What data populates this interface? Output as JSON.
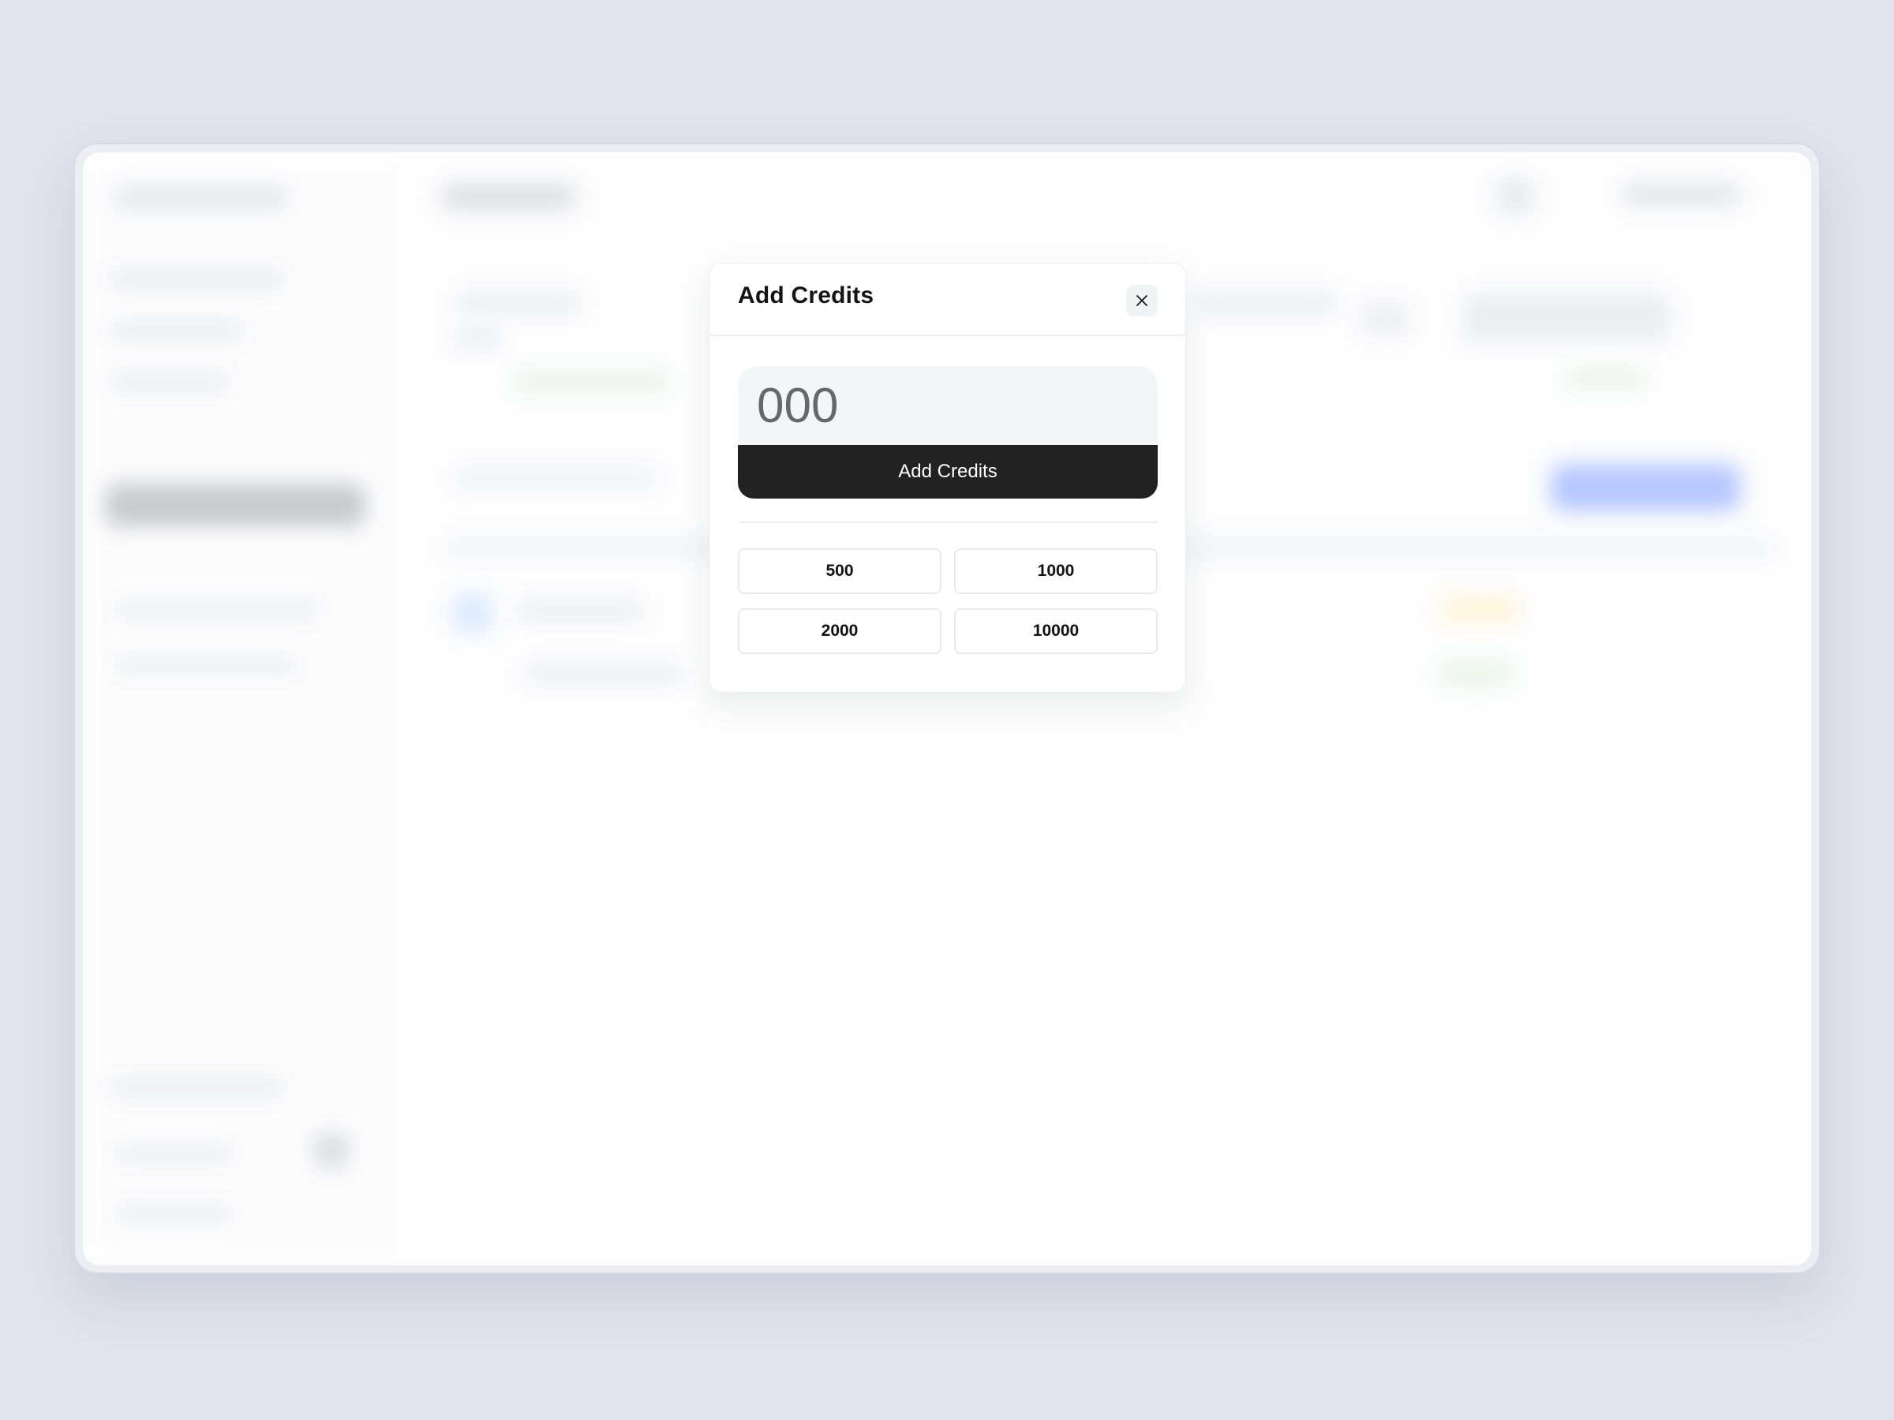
{
  "modal": {
    "title": "Add Credits",
    "amount_placeholder": "000",
    "submit_label": "Add Credits",
    "presets": [
      "500",
      "1000",
      "2000",
      "10000"
    ]
  },
  "icons": {
    "close": "close-icon"
  },
  "colors": {
    "page_background": "#e1e4ec",
    "primary_button": "#222222",
    "input_background": "#f4f5f7",
    "blurred_accent": "#9fb6ff"
  }
}
